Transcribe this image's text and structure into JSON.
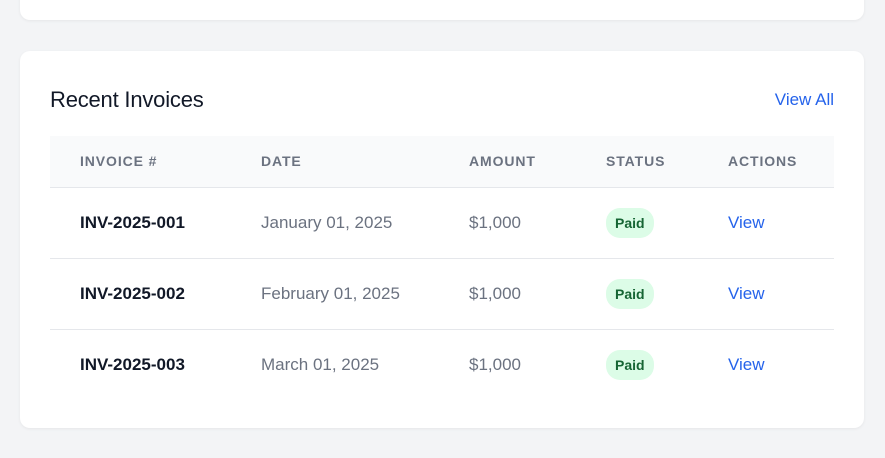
{
  "invoices": {
    "title": "Recent Invoices",
    "view_all_label": "View All",
    "columns": [
      "INVOICE #",
      "DATE",
      "AMOUNT",
      "STATUS",
      "ACTIONS"
    ],
    "rows": [
      {
        "invoice": "INV-2025-001",
        "date": "January 01, 2025",
        "amount": "$1,000",
        "status": "Paid",
        "action": "View"
      },
      {
        "invoice": "INV-2025-002",
        "date": "February 01, 2025",
        "amount": "$1,000",
        "status": "Paid",
        "action": "View"
      },
      {
        "invoice": "INV-2025-003",
        "date": "March 01, 2025",
        "amount": "$1,000",
        "status": "Paid",
        "action": "View"
      }
    ]
  },
  "colors": {
    "background": "#f3f4f6",
    "accent": "#2563eb",
    "status_paid_bg": "#dcfce7",
    "status_paid_text": "#166534"
  }
}
